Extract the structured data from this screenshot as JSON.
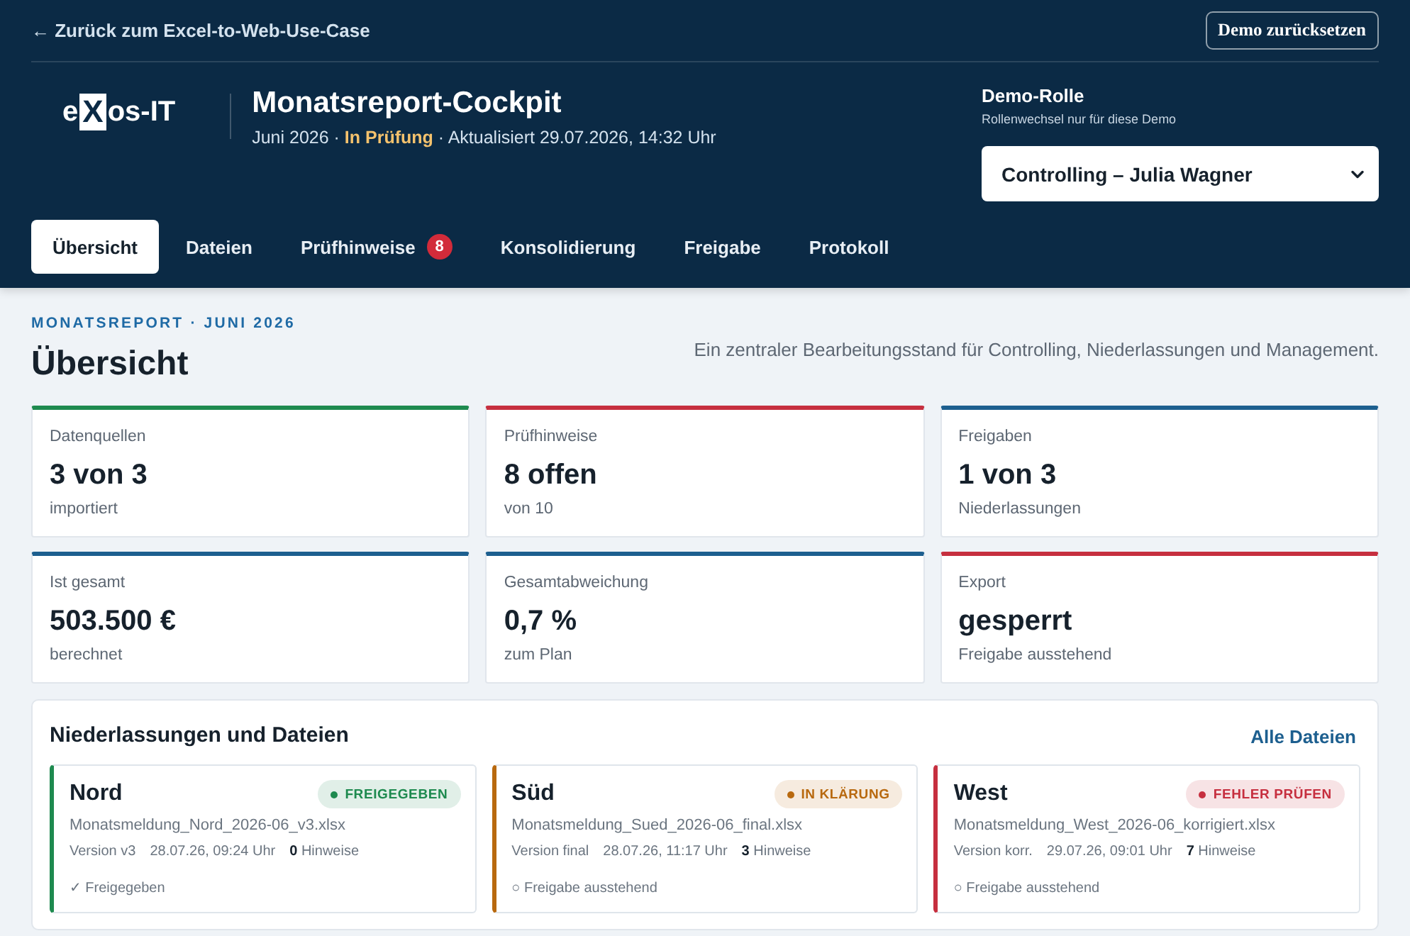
{
  "header": {
    "back_link": "← Zurück zum Excel-to-Web-Use-Case",
    "reset_button": "Demo zurücksetzen",
    "logo": {
      "prefix": "e",
      "boxed": "X",
      "suffix": "os-IT"
    },
    "title": "Monatsreport-Cockpit",
    "subtitle": "Juni 2026 · **In Prüfung** · Aktualisiert 29.07.2026, 14:32 Uhr",
    "role": {
      "label": "Demo-Rolle",
      "hint": "Rollenwechsel nur für diese Demo",
      "value": "Controlling – Julia Wagner"
    }
  },
  "tabs": [
    {
      "label": "Übersicht",
      "selected": true
    },
    {
      "label": "Dateien",
      "selected": false
    },
    {
      "label": "Prüfhinweise",
      "selected": false,
      "badge": "8"
    },
    {
      "label": "Konsolidierung",
      "selected": false
    },
    {
      "label": "Freigabe",
      "selected": false
    },
    {
      "label": "Protokoll",
      "selected": false
    }
  ],
  "page": {
    "eyebrow": "MONATSREPORT · JUNI 2026",
    "title": "Übersicht",
    "description": "Ein zentraler Bearbeitungsstand für Controlling, Niederlassungen und Management."
  },
  "kpis": [
    {
      "label": "Datenquellen",
      "value": "3 von 3",
      "note": "importiert",
      "color": "#1e8a4f"
    },
    {
      "label": "Prüfhinweise",
      "value": "8 offen",
      "note": "von 10",
      "color": "#c62f3f"
    },
    {
      "label": "Freigaben",
      "value": "1 von 3",
      "note": "Niederlassungen",
      "color": "#1d5f8f"
    },
    {
      "label": "Ist gesamt",
      "value": "503.500 €",
      "note": "berechnet",
      "color": "#1d5f8f"
    },
    {
      "label": "Gesamtabweichung",
      "value": "0,7 %",
      "note": "zum Plan",
      "color": "#1d5f8f"
    },
    {
      "label": "Export",
      "value": "gesperrt",
      "note": "Freigabe ausstehend",
      "color": "#c62f3f"
    }
  ],
  "branches_panel": {
    "title": "Niederlassungen und Dateien",
    "link": "Alle Dateien",
    "branches": [
      {
        "name": "Nord",
        "status": "FREIGEGEBEN",
        "color": "#1e8a4f",
        "file": "Monatsmeldung_Nord_2026-06_v3.xlsx",
        "version": "Version v3",
        "timestamp": "28.07.26, 09:24 Uhr",
        "notes": "**0** Hinweise",
        "approval": "✓ Freigegeben"
      },
      {
        "name": "Süd",
        "status": "IN KLÄRUNG",
        "color": "#b8690f",
        "file": "Monatsmeldung_Sued_2026-06_final.xlsx",
        "version": "Version final",
        "timestamp": "28.07.26, 11:17 Uhr",
        "notes": "**3** Hinweise",
        "approval": "○ Freigabe ausstehend"
      },
      {
        "name": "West",
        "status": "FEHLER PRÜFEN",
        "color": "#c62f3f",
        "file": "Monatsmeldung_West_2026-06_korrigiert.xlsx",
        "version": "Version korr.",
        "timestamp": "29.07.26, 09:01 Uhr",
        "notes": "**7** Hinweise",
        "approval": "○ Freigabe ausstehend"
      }
    ]
  }
}
